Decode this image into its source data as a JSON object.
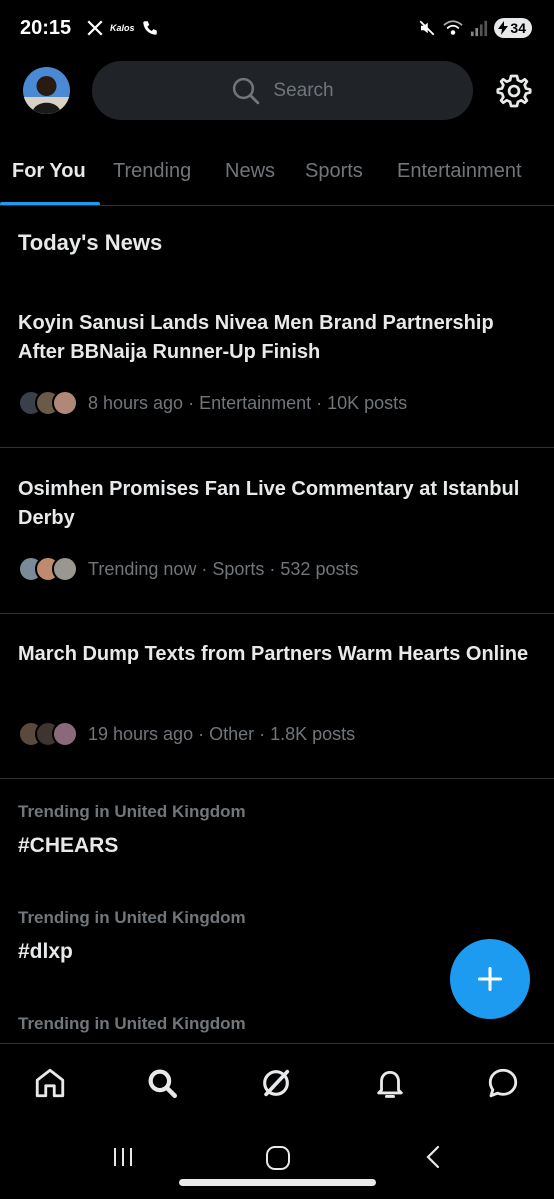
{
  "status_bar": {
    "time": "20:15",
    "app_label": "Kalos",
    "battery": "34"
  },
  "header": {
    "search_placeholder": "Search"
  },
  "tabs": [
    {
      "label": "For You",
      "active": true
    },
    {
      "label": "Trending",
      "active": false
    },
    {
      "label": "News",
      "active": false
    },
    {
      "label": "Sports",
      "active": false
    },
    {
      "label": "Entertainment",
      "active": false
    }
  ],
  "section_title": "Today's News",
  "news": [
    {
      "headline": "Koyin Sanusi Lands Nivea Men Brand Partnership After BBNaija Runner-Up Finish",
      "meta": "8 hours ago · Entertainment · 10K posts"
    },
    {
      "headline": "Osimhen Promises Fan Live Commentary at Istanbul Derby",
      "meta": "Trending now · Sports · 532 posts"
    },
    {
      "headline": "March Dump Texts from Partners Warm Hearts Online",
      "meta": "19 hours ago · Other · 1.8K posts"
    }
  ],
  "trends": [
    {
      "context": "Trending in United Kingdom",
      "tag": "#CHEARS"
    },
    {
      "context": "Trending in United Kingdom",
      "tag": "#dlxp"
    },
    {
      "context": "Trending in United Kingdom",
      "tag": ""
    }
  ],
  "colors": {
    "accent": "#1d9bf0",
    "background": "#000000",
    "secondary_text": "#71767b"
  }
}
